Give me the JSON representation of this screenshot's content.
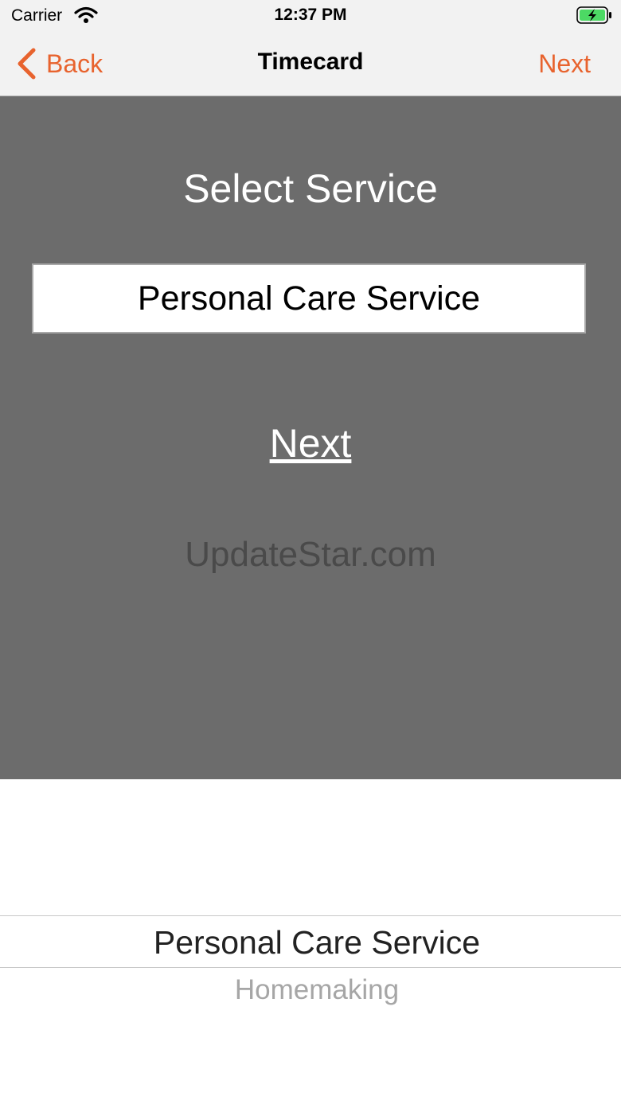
{
  "status_bar": {
    "carrier": "Carrier",
    "time": "12:37 PM",
    "battery_color": "#4cd964"
  },
  "nav": {
    "back_label": "Back",
    "title": "Timecard",
    "next_label": "Next",
    "accent_color": "#e8632e"
  },
  "main": {
    "heading": "Select Service",
    "selected_service": "Personal Care Service",
    "next_link": "Next",
    "watermark": "UpdateStar.com",
    "background_color": "#6c6c6c"
  },
  "picker": {
    "options": [
      "Personal Care Service",
      "Homemaking"
    ],
    "selected_index": 0
  },
  "icons": [
    "wifi-icon",
    "battery-icon",
    "chevron-left-icon"
  ]
}
